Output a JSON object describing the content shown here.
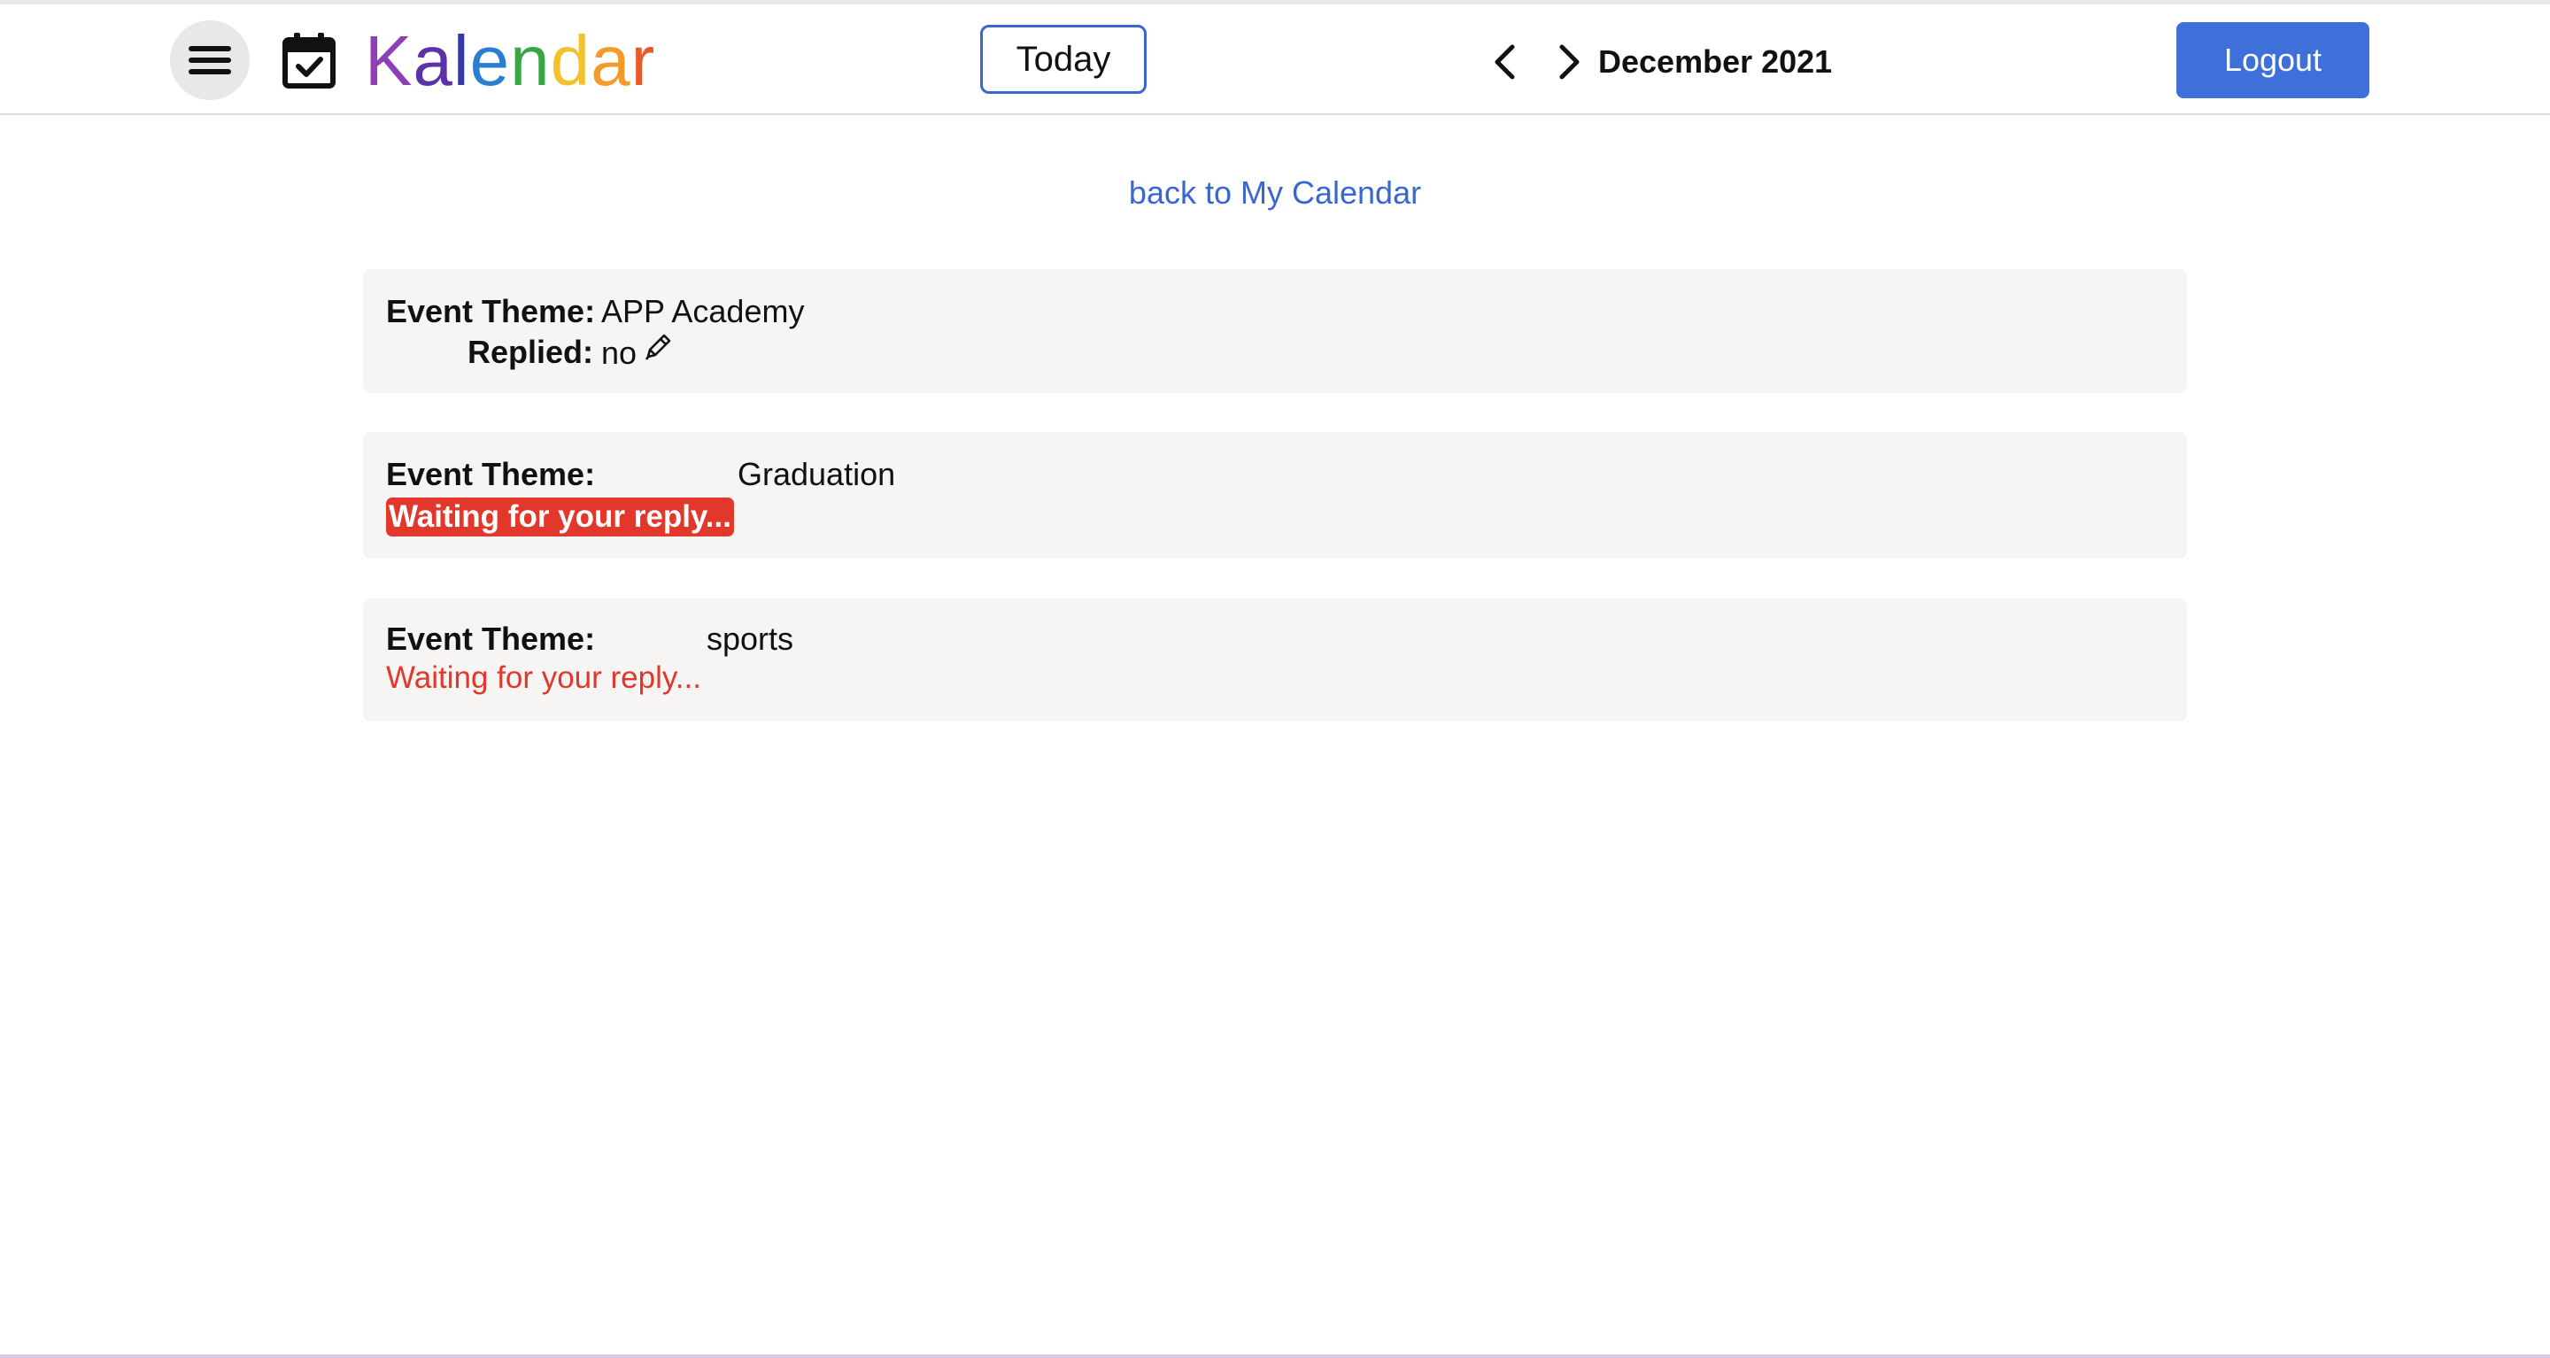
{
  "header": {
    "brand_letters": [
      {
        "char": "K",
        "color": "#8e3fb8"
      },
      {
        "char": "a",
        "color": "#5b32a8"
      },
      {
        "char": "l",
        "color": "#3437b0"
      },
      {
        "char": "e",
        "color": "#2a7ed0"
      },
      {
        "char": "n",
        "color": "#3aa545"
      },
      {
        "char": "d",
        "color": "#f2c12e"
      },
      {
        "char": "a",
        "color": "#f39a2b"
      },
      {
        "char": "r",
        "color": "#ea5a28"
      }
    ],
    "today_label": "Today",
    "month_label": "December 2021",
    "logout_label": "Logout",
    "icons": {
      "menu": "hamburger-menu-icon",
      "calendar": "calendar-check-icon",
      "prev": "chevron-left-icon",
      "next": "chevron-right-icon"
    }
  },
  "back_link": "back to My Calendar",
  "events": [
    {
      "theme_label": "Event Theme:",
      "theme": "APP Academy",
      "replied_label": "Replied:",
      "replied": "no"
    },
    {
      "theme_label": "Event Theme:",
      "theme": "Graduation",
      "status": "Waiting for your reply..."
    },
    {
      "theme_label": "Event Theme:",
      "theme": "sports",
      "status": "Waiting for your reply..."
    }
  ],
  "colors": {
    "accent_blue": "#3f6fd8",
    "link_blue": "#3a66d1",
    "alert_red": "#e2372b",
    "card_bg": "#f6f5f4"
  }
}
